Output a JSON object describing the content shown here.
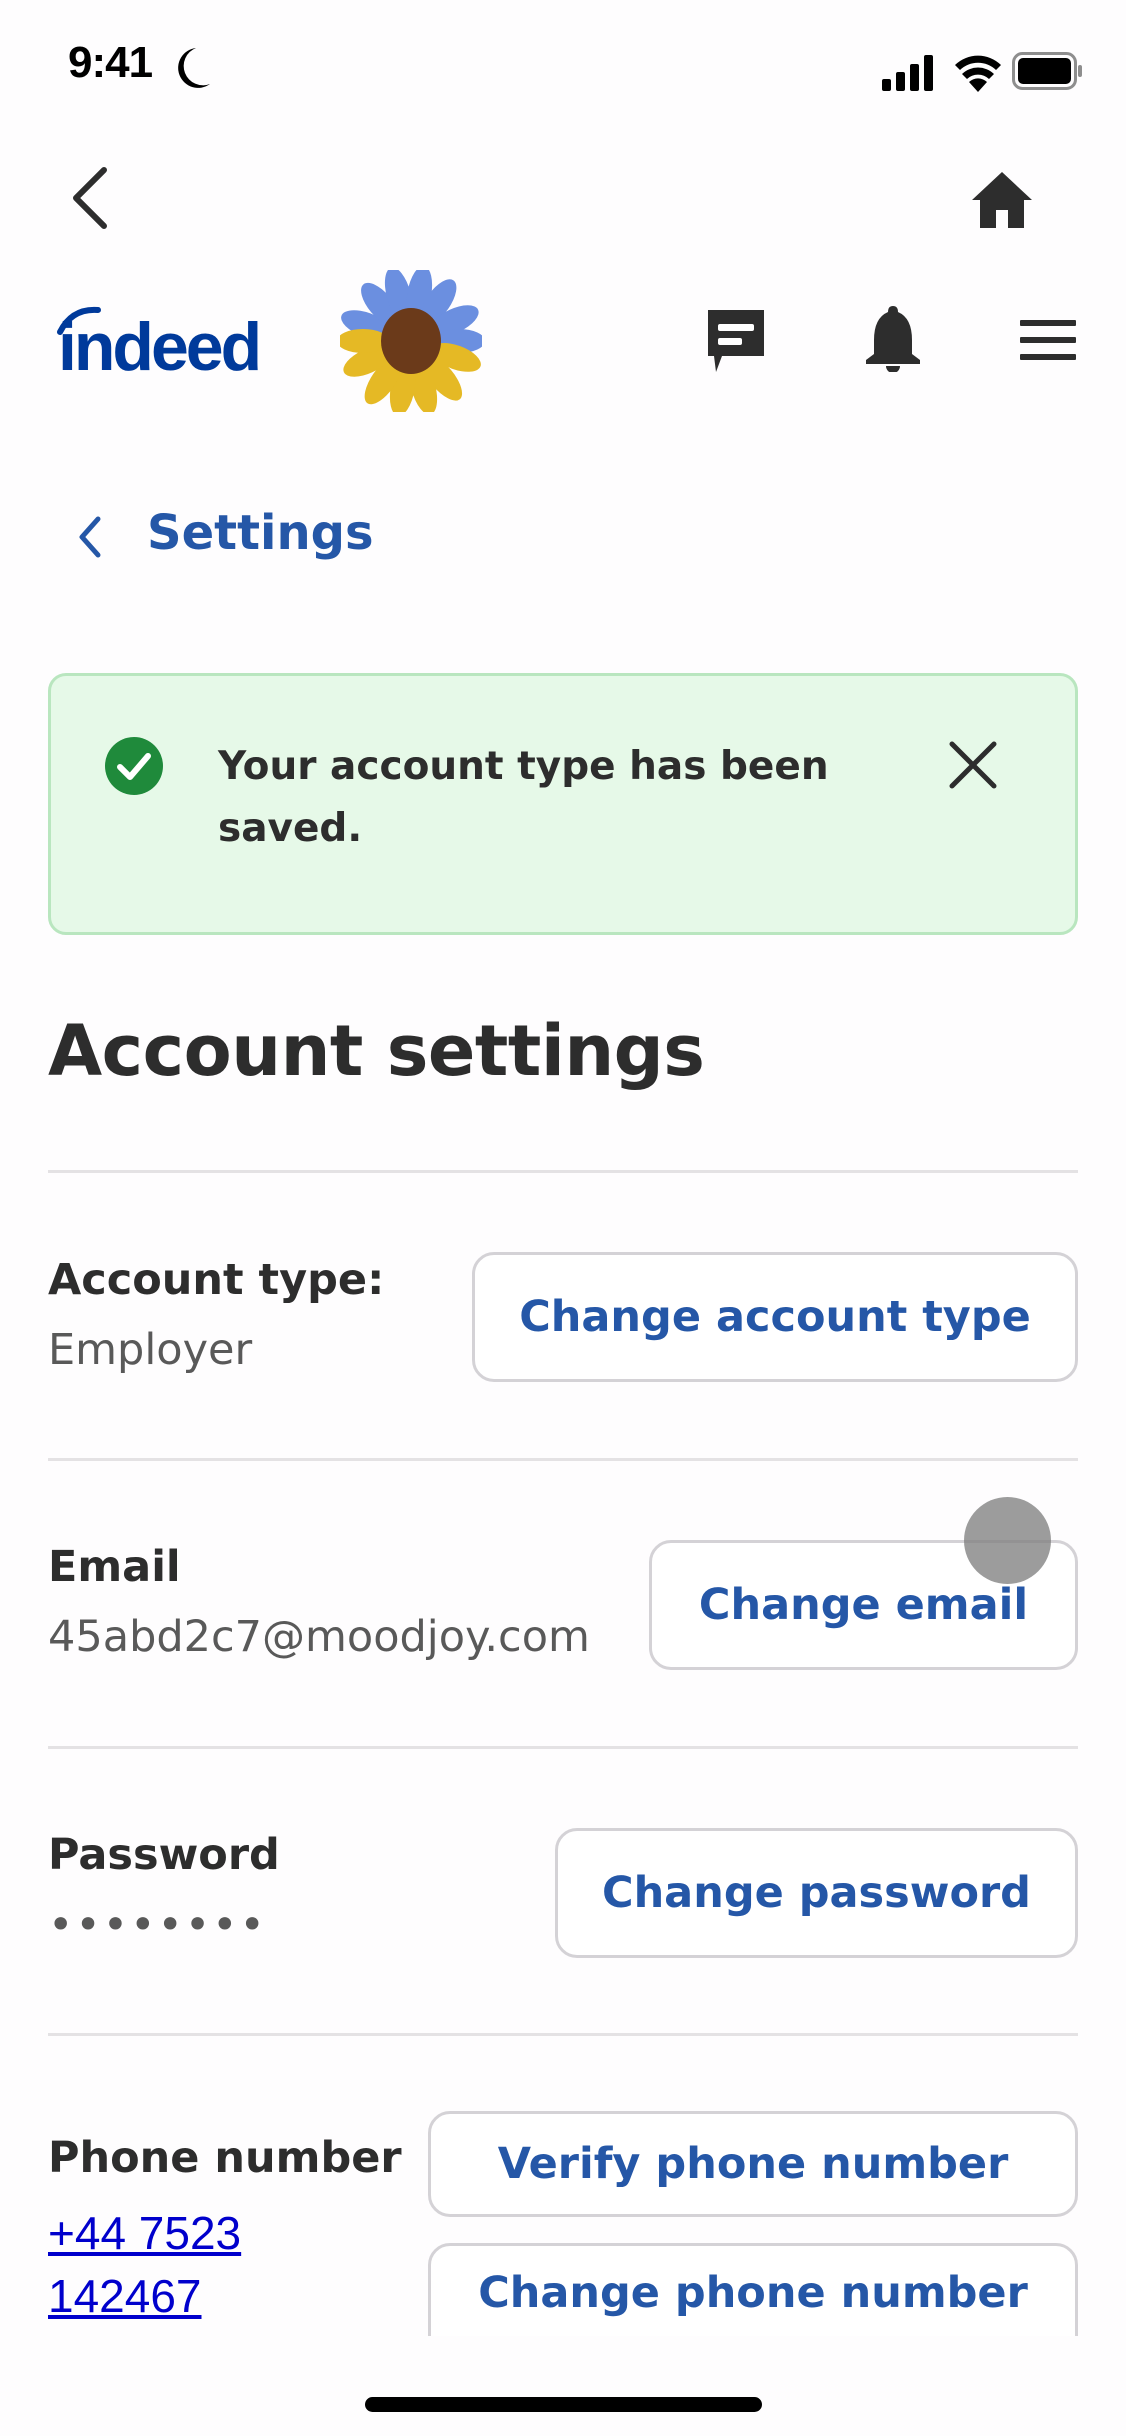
{
  "status_bar": {
    "time": "9:41",
    "icons": [
      "moon-icon",
      "cellular-signal-icon",
      "wifi-icon",
      "battery-icon"
    ]
  },
  "nav": {
    "back_icon": "chevron-left-icon",
    "home_icon": "home-icon"
  },
  "header": {
    "logo_text": "indeed",
    "brand_color": "#2557a7",
    "logo_color": "#003a9b",
    "icons": [
      "sunflower-logo",
      "messages-icon",
      "bell-icon",
      "menu-icon"
    ]
  },
  "breadcrumb": {
    "label": "Settings"
  },
  "alert": {
    "message": "Your account type has been saved.",
    "status": "success",
    "background": "#e6f9e8",
    "icon_color": "#1f8a3b"
  },
  "page": {
    "title": "Account settings"
  },
  "settings": {
    "account_type": {
      "label": "Account type:",
      "value": "Employer",
      "button": "Change account type"
    },
    "email": {
      "label": "Email",
      "value": "45abd2c7@moodjoy.com",
      "button": "Change email"
    },
    "password": {
      "label": "Password",
      "value": "••••••••",
      "button": "Change password"
    },
    "phone": {
      "label": "Phone number",
      "value_line1": "+44 7523",
      "value_line2": "142467",
      "verify_button": "Verify phone number",
      "change_button": "Change phone number"
    }
  }
}
